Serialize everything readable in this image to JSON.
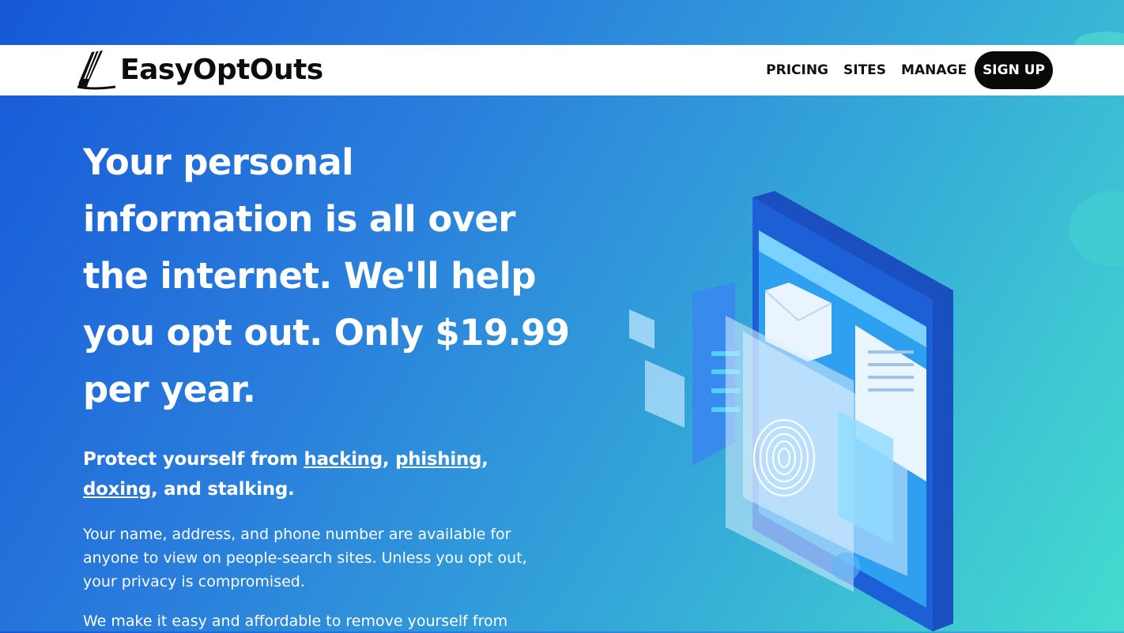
{
  "brand": {
    "name": "EasyOptOuts"
  },
  "nav": {
    "links": [
      "PRICING",
      "SITES",
      "MANAGE"
    ],
    "signup": "SIGN UP"
  },
  "hero": {
    "headline": "Your personal information is all over the internet. We'll help you opt out. Only $19.99 per year.",
    "protect": {
      "prefix": "Protect yourself from ",
      "hacking": "hacking",
      "sep1": ", ",
      "phishing": "phishing",
      "sep2": ",",
      "doxing": "doxing",
      "suffix": ", and stalking."
    },
    "para1": "Your name, address, and phone number are available for anyone to view on people-search sites. Unless you opt out, your privacy is compromised.",
    "para2": "We make it easy and affordable to remove yourself from"
  },
  "colors": {
    "gradient_start": "#1658d8",
    "gradient_end": "#45dccf",
    "nav_bg": "#ffffff",
    "signup_bg": "#0a0a0a"
  },
  "icons": {
    "logo": "eraser-icon",
    "illustration": "phone-fingerprint-illustration"
  }
}
